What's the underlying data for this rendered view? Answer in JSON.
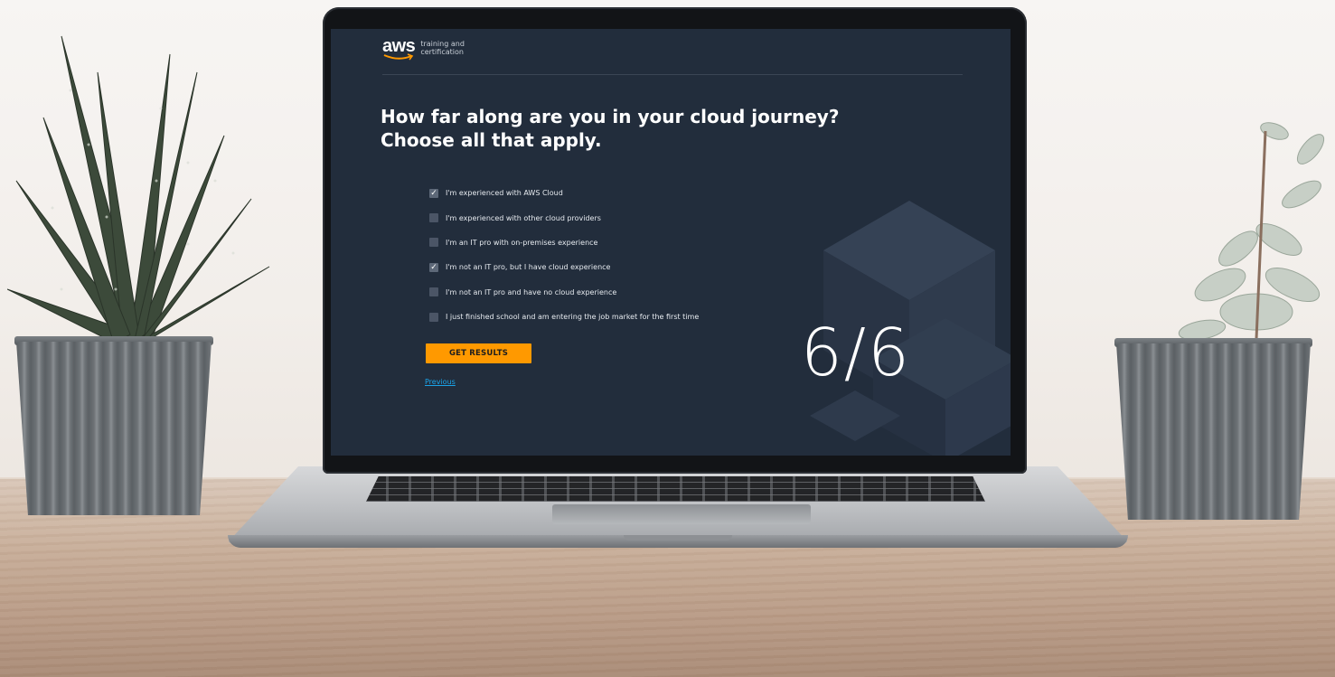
{
  "brand": {
    "logo_text": "aws",
    "tagline_line1": "training and",
    "tagline_line2": "certification",
    "accent_color": "#FF9900"
  },
  "question": {
    "line1": "How far along are you in your cloud journey?",
    "line2": "Choose all that apply."
  },
  "options": [
    {
      "label": "I'm experienced with AWS Cloud",
      "checked": true
    },
    {
      "label": "I'm experienced with other cloud providers",
      "checked": false
    },
    {
      "label": "I'm an IT pro with on-premises experience",
      "checked": false
    },
    {
      "label": "I'm not an IT pro, but I have cloud experience",
      "checked": true
    },
    {
      "label": "I'm not an IT pro and have no cloud experience",
      "checked": false
    },
    {
      "label": "I just finished school and am entering the job market for the first time",
      "checked": false
    }
  ],
  "actions": {
    "submit_label": "GET RESULTS",
    "previous_label": "Previous"
  },
  "progress": {
    "display": "6/6",
    "current": 6,
    "total": 6
  },
  "icons": {
    "checkmark": "check-icon"
  }
}
